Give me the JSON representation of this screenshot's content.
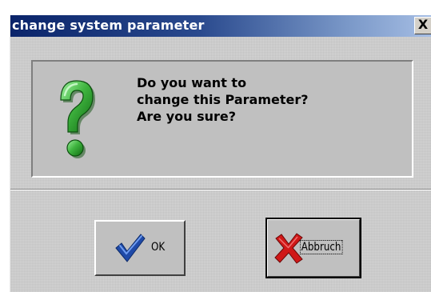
{
  "window": {
    "title": "change system parameter",
    "close_glyph": "X"
  },
  "dialog": {
    "icon": "question-icon",
    "message_lines": [
      "Do you want to",
      "change this Parameter?",
      "Are you sure?"
    ]
  },
  "buttons": {
    "ok": {
      "label": "OK",
      "icon": "check-icon"
    },
    "cancel": {
      "label": "Abbruch",
      "icon": "red-x-icon"
    }
  },
  "colors": {
    "title_start": "#0a246a",
    "title_end": "#a6bee4",
    "icon_green": "#3fb43f",
    "check_blue": "#1f4aa8",
    "cross_red": "#d01818"
  }
}
